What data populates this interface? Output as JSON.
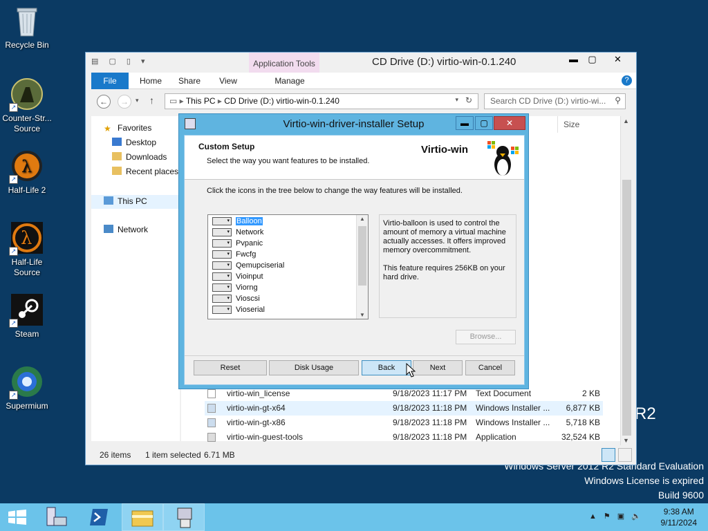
{
  "desktop": {
    "icons": [
      {
        "label": "Recycle Bin"
      },
      {
        "label": "Counter-Str... Source"
      },
      {
        "label": "Half-Life 2"
      },
      {
        "label": "Half-Life Source"
      },
      {
        "label": "Steam"
      },
      {
        "label": "Supermium"
      }
    ],
    "watermark": {
      "line1": "Windows Server 2012 R2 Standard Evaluation",
      "line2": "Windows License is expired",
      "line3": "Build 9600",
      "r2": "R2"
    }
  },
  "explorer": {
    "title": "CD Drive (D:) virtio-win-0.1.240",
    "context_tab": "Application Tools",
    "ribbon_tabs": [
      "File",
      "Home",
      "Share",
      "View",
      "Manage"
    ],
    "address": {
      "this_pc": "This PC",
      "path": "CD Drive (D:) virtio-win-0.1.240"
    },
    "search_placeholder": "Search CD Drive (D:) virtio-wi...",
    "nav": {
      "favorites": "Favorites",
      "desktop": "Desktop",
      "downloads": "Downloads",
      "recent": "Recent places",
      "this_pc": "This PC",
      "network": "Network"
    },
    "column_size": "Size",
    "files": [
      {
        "name": "virtio-win_license",
        "date": "9/18/2023 11:17 PM",
        "type": "Text Document",
        "size": "2 KB"
      },
      {
        "name": "virtio-win-gt-x64",
        "date": "9/18/2023 11:18 PM",
        "type": "Windows Installer ...",
        "size": "6,877 KB"
      },
      {
        "name": "virtio-win-gt-x86",
        "date": "9/18/2023 11:18 PM",
        "type": "Windows Installer ...",
        "size": "5,718 KB"
      },
      {
        "name": "virtio-win-guest-tools",
        "date": "9/18/2023 11:18 PM",
        "type": "Application",
        "size": "32,524 KB"
      }
    ],
    "status": {
      "items": "26 items",
      "selected": "1 item selected",
      "size": "6.71 MB"
    }
  },
  "dialog": {
    "title": "Virtio-win-driver-installer Setup",
    "header_title": "Custom Setup",
    "header_subtitle": "Select the way you want features to be installed.",
    "brand": "Virtio-win",
    "instruction": "Click the icons in the tree below to change the way features will be installed.",
    "features": [
      "Balloon",
      "Network",
      "Pvpanic",
      "Fwcfg",
      "Qemupciserial",
      "Vioinput",
      "Viorng",
      "Vioscsi",
      "Vioserial"
    ],
    "description_p1": "Virtio-balloon is used to control the amount of memory a virtual machine actually accesses. It offers improved memory overcommitment.",
    "description_p2": "This feature requires 256KB on your hard drive.",
    "buttons": {
      "browse": "Browse...",
      "reset": "Reset",
      "disk_usage": "Disk Usage",
      "back": "Back",
      "next": "Next",
      "cancel": "Cancel"
    }
  },
  "taskbar": {
    "time": "9:38 AM",
    "date": "9/11/2024"
  }
}
